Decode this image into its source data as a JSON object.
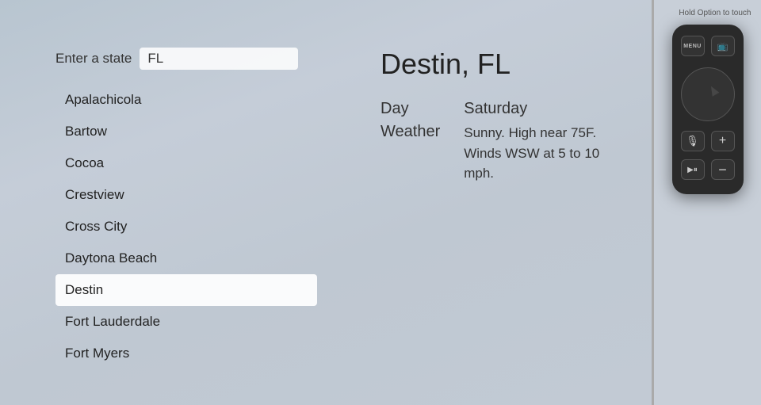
{
  "tv": {
    "state_label": "Enter a state",
    "state_value": "FL",
    "cities": [
      {
        "name": "Apalachicola",
        "selected": false
      },
      {
        "name": "Bartow",
        "selected": false
      },
      {
        "name": "Cocoa",
        "selected": false
      },
      {
        "name": "Crestview",
        "selected": false
      },
      {
        "name": "Cross City",
        "selected": false
      },
      {
        "name": "Daytona Beach",
        "selected": false
      },
      {
        "name": "Destin",
        "selected": true
      },
      {
        "name": "Fort Lauderdale",
        "selected": false
      },
      {
        "name": "Fort Myers",
        "selected": false
      }
    ],
    "weather": {
      "city": "Destin, FL",
      "day_label": "Day",
      "weather_label": "Weather",
      "day_value": "Saturday",
      "weather_value": "Sunny. High near 75F. Winds WSW at 5 to 10 mph."
    }
  },
  "remote": {
    "hint": "Hold Option to touch",
    "menu_label": "MENU",
    "tv_icon": "⬛",
    "mic_icon": "🎤",
    "plus_icon": "+",
    "play_pause_icon": "▶⏸",
    "minus_icon": "−"
  }
}
